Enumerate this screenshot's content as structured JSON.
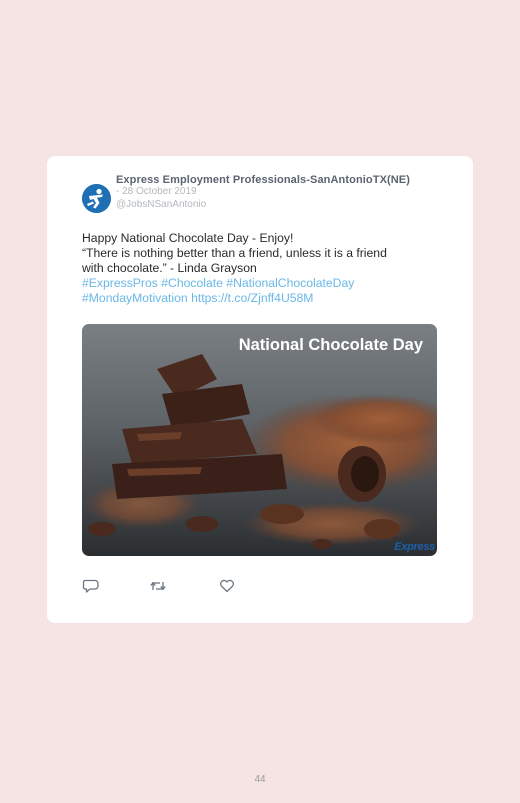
{
  "post": {
    "author_name": "Express Employment Professionals-SanAntonioTX(NE)",
    "date": "- 28 October 2019",
    "handle": "@JobsNSanAntonio",
    "text_lines": [
      "Happy National Chocolate Day - Enjoy!",
      "“There is nothing better than a friend, unless it is a friend",
      "with chocolate.” - Linda Grayson"
    ],
    "link_lines": [
      "#ExpressPros #Chocolate #NationalChocolateDay",
      "#MondayMotivation https://t.co/Zjnff4U58M"
    ],
    "media": {
      "title": "National Chocolate Day",
      "logo_text": "Express"
    }
  },
  "actions": {
    "reply_icon": "reply-icon",
    "retweet_icon": "retweet-icon",
    "like_icon": "heart-icon"
  },
  "footer": {
    "page_number": "44"
  },
  "colors": {
    "page_background": "#f6e3e4",
    "card_background": "#ffffff",
    "link": "#69b7e6",
    "brand_blue": "#1f6fb5"
  }
}
